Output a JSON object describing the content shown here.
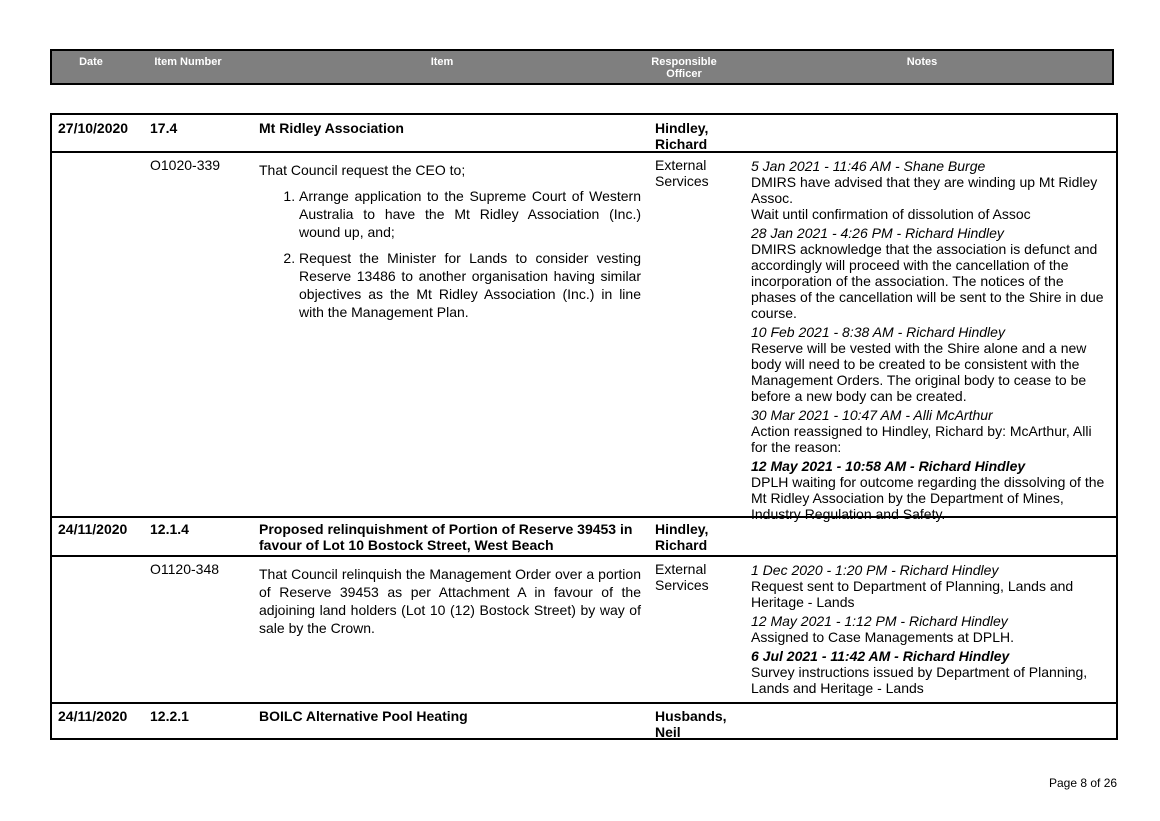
{
  "header": {
    "date": "Date",
    "item_number": "Item Number",
    "item": "Item",
    "responsible_officer": "Responsible Officer",
    "notes": "Notes"
  },
  "items": [
    {
      "date": "27/10/2020",
      "item_number": "17.4",
      "item_title": "Mt Ridley Association",
      "officer": "Hindley, Richard",
      "action_number": "O1020-339",
      "motion_intro": "That Council request the CEO to;",
      "motion_points": [
        "Arrange application to the Supreme Court of Western Australia to have the Mt Ridley Association (Inc.) wound up, and;",
        "Request the Minister for Lands to consider vesting Reserve 13486 to another organisation having similar objectives as the Mt Ridley Association (Inc.) in line with the Management Plan."
      ],
      "action_officer": "External Services",
      "notes": [
        {
          "heading": "5 Jan 2021 - 11:46 AM - Shane Burge",
          "body": "DMIRS have advised that they are winding up Mt Ridley Assoc.",
          "body2": "Wait until confirmation of dissolution of Assoc"
        },
        {
          "heading": "28 Jan 2021 - 4:26 PM - Richard Hindley",
          "body": "DMIRS acknowledge that the association is defunct and accordingly will proceed with the cancellation of the incorporation of the association. The notices of the phases of the cancellation will be sent to the Shire in due course."
        },
        {
          "heading": "10 Feb 2021 - 8:38 AM - Richard Hindley",
          "body": "Reserve will be vested with the Shire alone and a new body will need to be created to be consistent with the Management Orders. The original body to cease to be before a new body can be created."
        },
        {
          "heading": "30 Mar 2021 - 10:47 AM - Alli McArthur",
          "body": "Action reassigned to Hindley, Richard by: McArthur, Alli for the reason:"
        },
        {
          "heading": "12 May 2021 - 10:58 AM - Richard Hindley",
          "body": "DPLH waiting for outcome regarding the dissolving of the Mt Ridley Association by the Department of Mines, Industry Regulation and Safety."
        }
      ]
    },
    {
      "date": "24/11/2020",
      "item_number": "12.1.4",
      "item_title": "Proposed relinquishment of Portion of Reserve 39453 in favour of Lot 10 Bostock Street, West Beach",
      "officer": "Hindley, Richard",
      "action_number": "O1120-348",
      "motion_intro": "That Council relinquish the Management Order over a portion of Reserve 39453 as per Attachment A in favour of the adjoining land holders (Lot 10 (12) Bostock Street) by way of sale by the Crown.",
      "action_officer": "External Services",
      "notes": [
        {
          "heading": "1 Dec 2020 - 1:20 PM - Richard Hindley",
          "body": "Request sent to Department of Planning, Lands and Heritage - Lands"
        },
        {
          "heading": "12 May 2021 - 1:12 PM - Richard Hindley",
          "body": "Assigned to Case Managements at DPLH."
        },
        {
          "heading": "6 Jul 2021 - 11:42 AM - Richard Hindley",
          "body": "Survey instructions issued by Department of Planning, Lands and Heritage - Lands"
        }
      ]
    },
    {
      "date": "24/11/2020",
      "item_number": "12.2.1",
      "item_title": "BOILC Alternative Pool Heating",
      "officer": "Husbands, Neil"
    }
  ],
  "footer": {
    "page": "Page 8 of 26"
  }
}
